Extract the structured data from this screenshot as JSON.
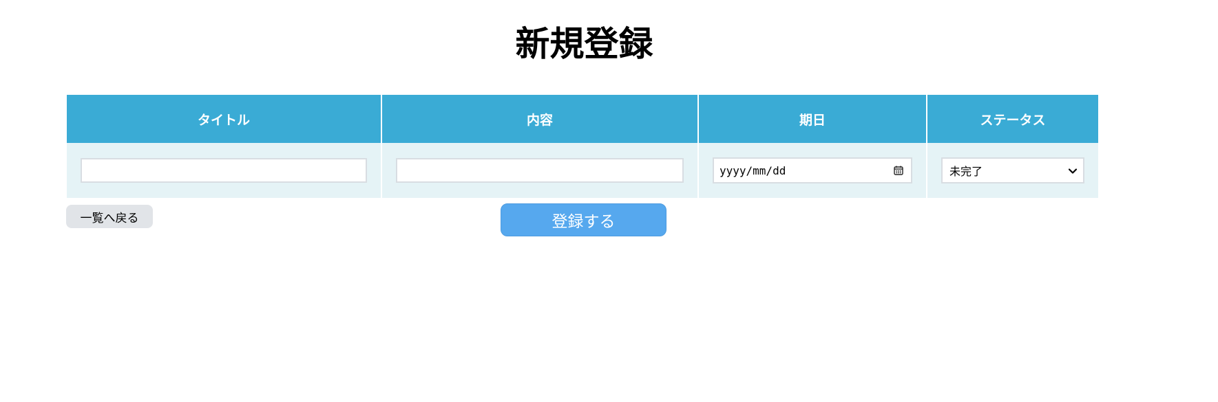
{
  "page": {
    "title": "新規登録"
  },
  "table": {
    "headers": {
      "title": "タイトル",
      "content": "内容",
      "date": "期日",
      "status": "ステータス"
    },
    "inputs": {
      "title_value": "",
      "content_value": "",
      "date_placeholder": "yyyy/mm/dd",
      "status_selected": "未完了"
    }
  },
  "actions": {
    "back_label": "一覧へ戻る",
    "submit_label": "登録する"
  },
  "icons": {
    "date_picker": "calendar-icon",
    "status_dropdown": "chevron-down-icon"
  },
  "colors": {
    "header_bg": "#3aabd5",
    "row_bg": "#e5f3f6",
    "submit_bg": "#56a8ee",
    "back_bg": "#e1e4e8"
  }
}
